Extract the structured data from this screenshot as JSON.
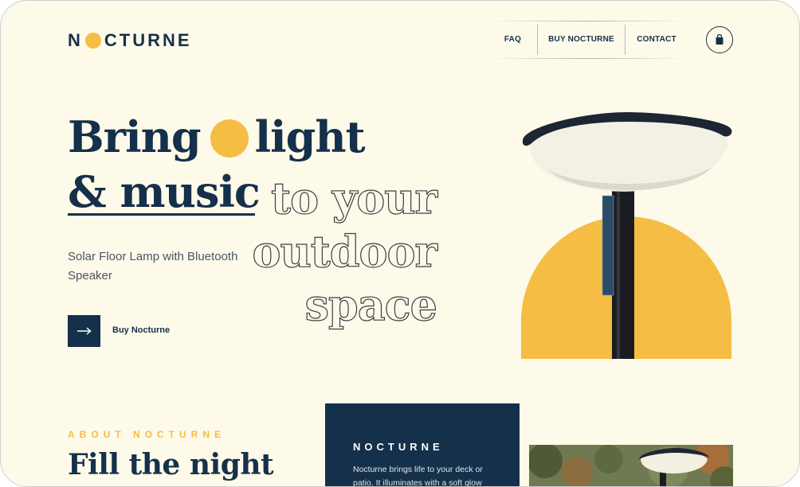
{
  "brand": {
    "name_prefix": "N",
    "name_suffix": "CTURNE"
  },
  "nav": {
    "items": [
      "FAQ",
      "BUY NOCTURNE",
      "CONTACT"
    ]
  },
  "icons": {
    "cart": "shopping-bag-icon",
    "cta": "arrow-right-icon"
  },
  "hero": {
    "line1_start": "Bring",
    "line1_end": "light",
    "line2": "& music",
    "outline_lines": [
      "to your",
      "outdoor",
      "space"
    ],
    "subtitle": "Solar Floor Lamp with Bluetooth Speaker",
    "cta_label": "Buy Nocturne"
  },
  "about": {
    "kicker": "ABOUT NOCTURNE",
    "title": "Fill the night",
    "card_title": "NOCTURNE",
    "card_body": "Nocturne brings life to your deck or patio. It illuminates with a soft glow"
  },
  "colors": {
    "navy": "#15304a",
    "accent": "#f5bd43",
    "background": "#fefaea"
  }
}
